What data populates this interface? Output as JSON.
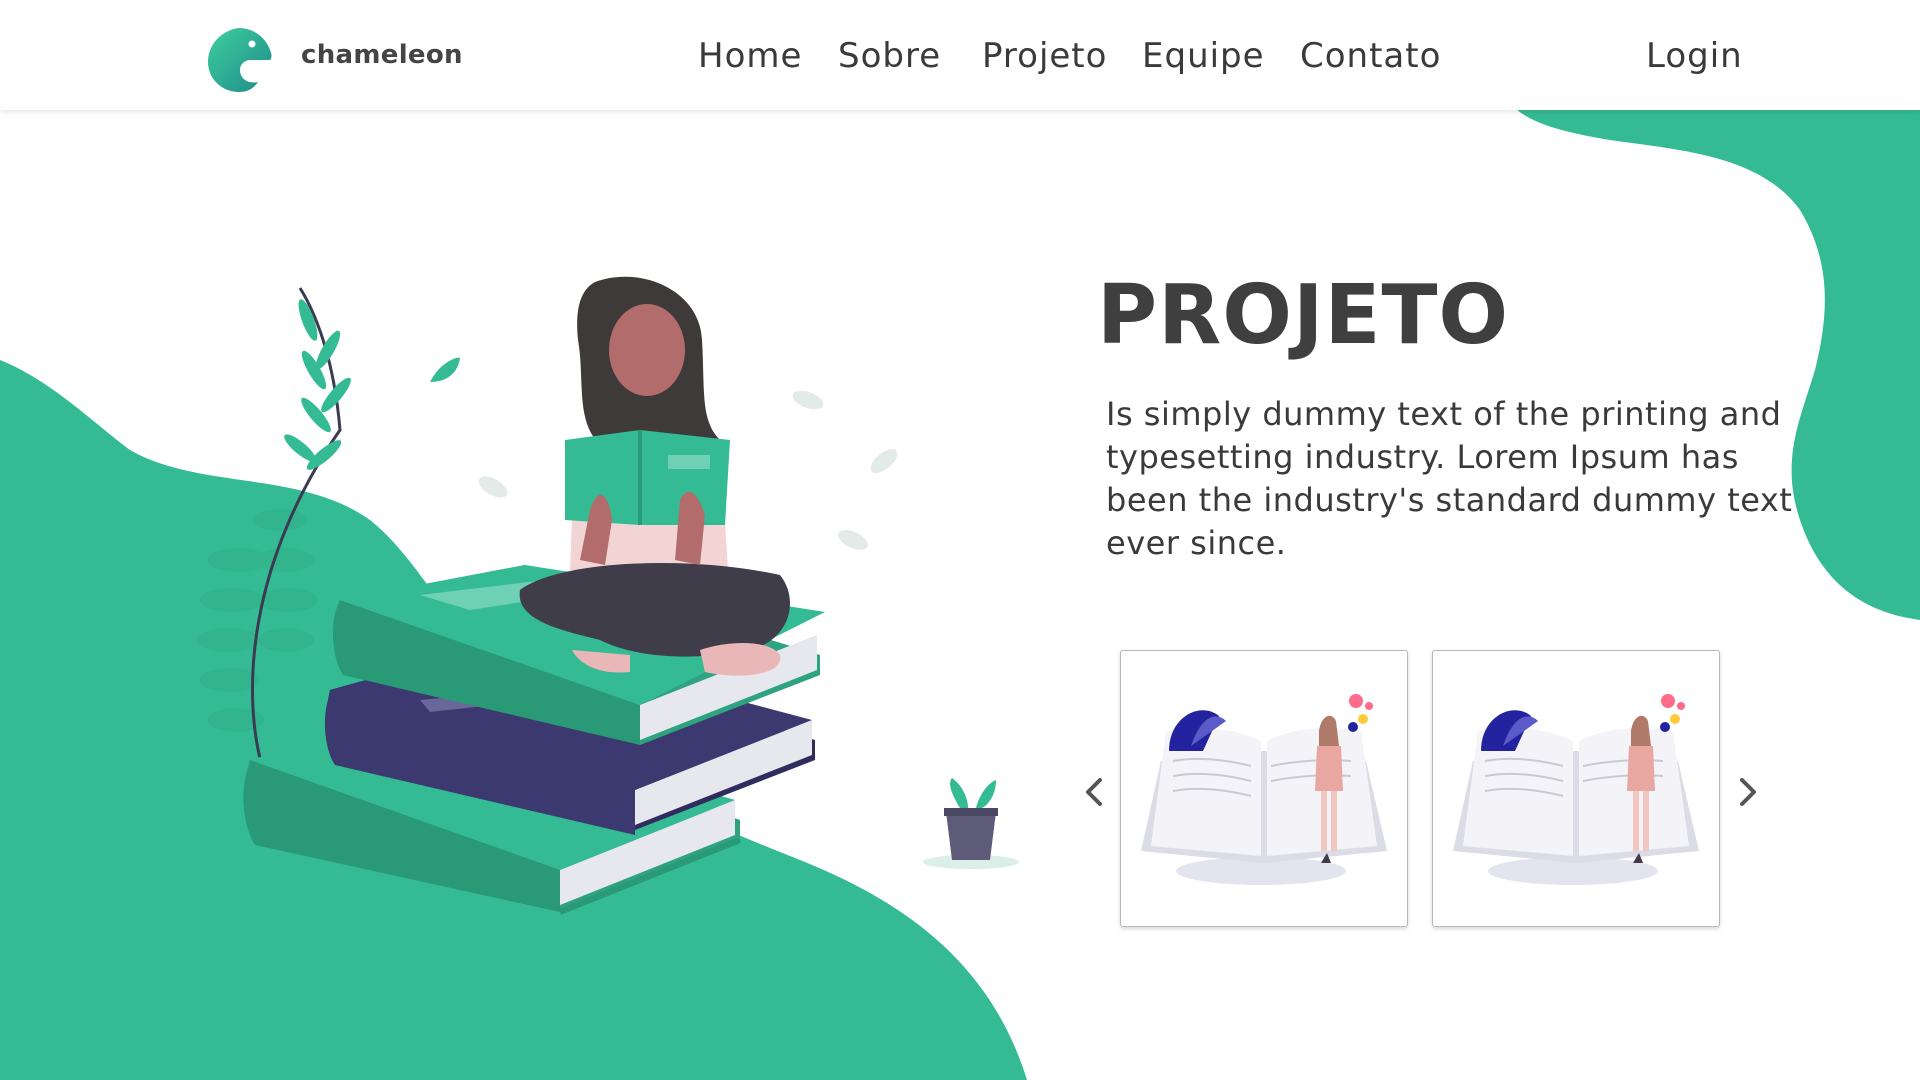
{
  "header": {
    "brand": "chameleon",
    "nav": [
      {
        "label": "Home"
      },
      {
        "label": "Sobre"
      },
      {
        "label": "Projeto"
      },
      {
        "label": "Equipe"
      },
      {
        "label": "Contato"
      }
    ],
    "login_label": "Login"
  },
  "hero": {
    "title": "PROJETO",
    "description": "Is simply dummy text of the printing  and typesetting industry. Lorem Ipsum has been the industry's standard dummy text ever since."
  },
  "carousel": {
    "prev_icon": "chevron-left-icon",
    "next_icon": "chevron-right-icon",
    "cards": [
      {
        "image": "reading-book-illustration"
      },
      {
        "image": "reading-book-illustration"
      }
    ]
  },
  "colors": {
    "accent_green": "#35bb93",
    "dark_text": "#3f3f3f",
    "book_purple": "#3c3870"
  }
}
